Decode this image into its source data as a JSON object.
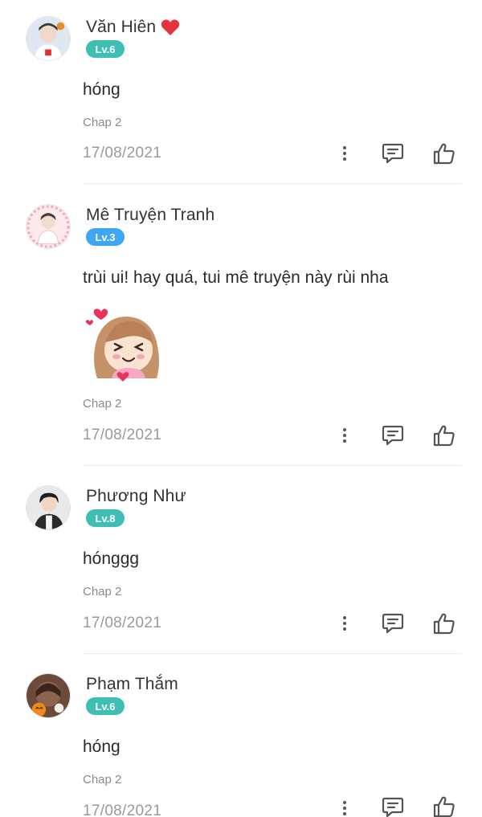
{
  "comments": [
    {
      "user": "Văn Hiên",
      "has_heart": true,
      "level": "Lv.6",
      "level_color": "#3fbfb4",
      "text": "hóng",
      "chapter": "Chap 2",
      "date": "17/08/2021"
    },
    {
      "user": "Mê Truyện Tranh",
      "has_heart": false,
      "level": "Lv.3",
      "level_color": "#3ea6f2",
      "text": "trùi ui! hay quá, tui mê truyện này rùi nha",
      "sticker": "cute-girl-laughing-sticker",
      "chapter": "Chap 2",
      "date": "17/08/2021"
    },
    {
      "user": "Phương Như",
      "has_heart": false,
      "level": "Lv.8",
      "level_color": "#3fbfb4",
      "text": "hónggg",
      "chapter": "Chap 2",
      "date": "17/08/2021"
    },
    {
      "user": "Phạm Thắm",
      "has_heart": false,
      "level": "Lv.6",
      "level_color": "#3fbfb4",
      "text": "hóng",
      "chapter": "Chap 2",
      "date": "17/08/2021"
    }
  ],
  "icons": {
    "more": "more-vertical-icon",
    "reply": "reply-comment-icon",
    "like": "thumbs-up-icon",
    "heart": "heart-icon"
  },
  "colors": {
    "icon": "#555555",
    "divider": "#ececec",
    "heart": "#e5343d"
  }
}
